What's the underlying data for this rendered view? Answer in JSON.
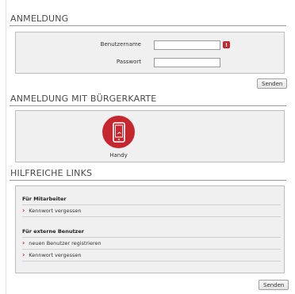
{
  "login": {
    "title": "ANMELDUNG",
    "username_label": "Benutzername",
    "username_value": "",
    "password_label": "Passwort",
    "password_value": "",
    "info_badge": "!",
    "submit_label": "Senden"
  },
  "citizen_card": {
    "title": "ANMELDUNG MIT BÜRGERKARTE",
    "handy_label": "Handy",
    "handy_icon": "mobile-phone-icon"
  },
  "links": {
    "title": "HILFREICHE LINKS",
    "groups": [
      {
        "title": "Für Mitarbeiter",
        "items": [
          "Kennwort vergessen"
        ]
      },
      {
        "title": "Für externe Benutzer",
        "items": [
          "neuen Benutzer registrieren",
          "Kennwort vergessen"
        ]
      }
    ],
    "submit_label": "Senden"
  },
  "colors": {
    "accent": "#c6262e",
    "panel": "#f0f0f0",
    "border": "#bdbdbd"
  }
}
